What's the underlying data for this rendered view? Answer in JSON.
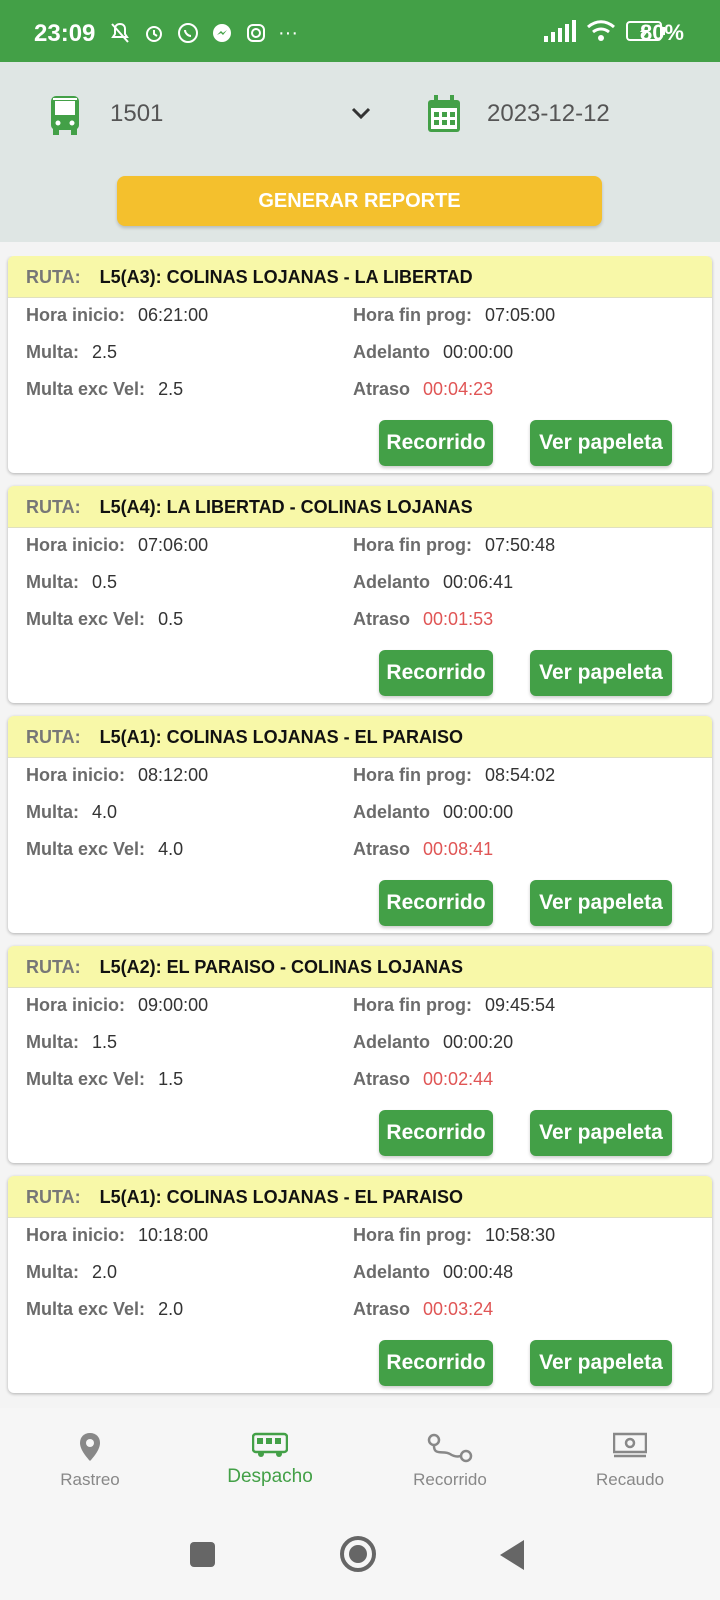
{
  "status": {
    "time": "23:09",
    "battery_pct": "80%",
    "dots": "···"
  },
  "filters": {
    "vehicle": "1501",
    "date": "2023-12-12",
    "generate_label": "GENERAR REPORTE"
  },
  "labels": {
    "ruta": "RUTA:",
    "hora_inicio": "Hora inicio:",
    "multa": "Multa:",
    "multa_exc": "Multa exc Vel:",
    "hora_fin": "Hora fin prog:",
    "adelanto": "Adelanto",
    "atraso": "Atraso",
    "btn_recorrido": "Recorrido",
    "btn_papeleta": "Ver papeleta"
  },
  "trips": [
    {
      "ruta": "L5(A3): COLINAS LOJANAS - LA LIBERTAD",
      "hora_inicio": "06:21:00",
      "multa": "2.5",
      "multa_exc": "2.5",
      "hora_fin": "07:05:00",
      "adelanto": "00:00:00",
      "atraso": "00:04:23"
    },
    {
      "ruta": "L5(A4): LA LIBERTAD - COLINAS LOJANAS",
      "hora_inicio": "07:06:00",
      "multa": "0.5",
      "multa_exc": "0.5",
      "hora_fin": "07:50:48",
      "adelanto": "00:06:41",
      "atraso": "00:01:53"
    },
    {
      "ruta": "L5(A1): COLINAS LOJANAS - EL PARAISO",
      "hora_inicio": "08:12:00",
      "multa": "4.0",
      "multa_exc": "4.0",
      "hora_fin": "08:54:02",
      "adelanto": "00:00:00",
      "atraso": "00:08:41"
    },
    {
      "ruta": "L5(A2): EL PARAISO - COLINAS LOJANAS",
      "hora_inicio": "09:00:00",
      "multa": "1.5",
      "multa_exc": "1.5",
      "hora_fin": "09:45:54",
      "adelanto": "00:00:20",
      "atraso": "00:02:44"
    },
    {
      "ruta": "L5(A1): COLINAS LOJANAS - EL PARAISO",
      "hora_inicio": "10:18:00",
      "multa": "2.0",
      "multa_exc": "2.0",
      "hora_fin": "10:58:30",
      "adelanto": "00:00:48",
      "atraso": "00:03:24"
    }
  ],
  "nav": [
    {
      "label": "Rastreo",
      "icon": "location-pin-icon"
    },
    {
      "label": "Despacho",
      "icon": "bus-icon",
      "active": true
    },
    {
      "label": "Recorrido",
      "icon": "route-icon"
    },
    {
      "label": "Recaudo",
      "icon": "cash-icon"
    }
  ],
  "colors": {
    "primary_green": "#43a047",
    "accent_yellow": "#f4c02d",
    "card_header": "#f8f8a8",
    "atraso_red": "#e05555"
  }
}
